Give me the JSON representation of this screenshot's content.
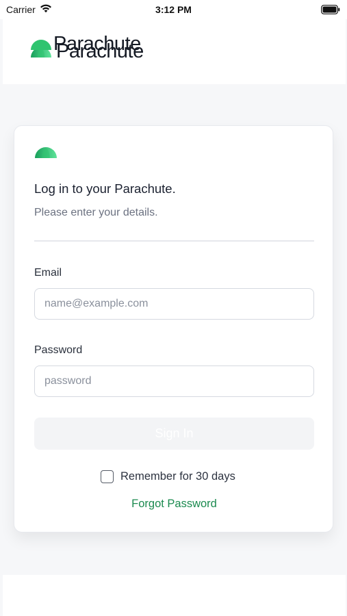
{
  "status_bar": {
    "carrier": "Carrier",
    "time": "3:12 PM",
    "icons": [
      "wifi-icon",
      "battery-icon"
    ]
  },
  "header": {
    "brand_name": "Parachute",
    "logo_icon": "parachute-logo-icon"
  },
  "login_card": {
    "title": "Log in to your Parachute.",
    "subtitle": "Please enter your details.",
    "email": {
      "label": "Email",
      "placeholder": "name@example.com",
      "value": ""
    },
    "password": {
      "label": "Password",
      "placeholder": "password",
      "value": ""
    },
    "sign_in_label": "Sign In",
    "remember_label": "Remember for 30 days",
    "remember_checked": false,
    "forgot_label": "Forgot Password"
  },
  "footer": {
    "brand_name": "Parachute"
  },
  "colors": {
    "brand_green": "#1b8a4f",
    "logo_green_light": "#3fd17f",
    "logo_green_dark": "#18a05a",
    "page_background": "#f6f7f9"
  }
}
